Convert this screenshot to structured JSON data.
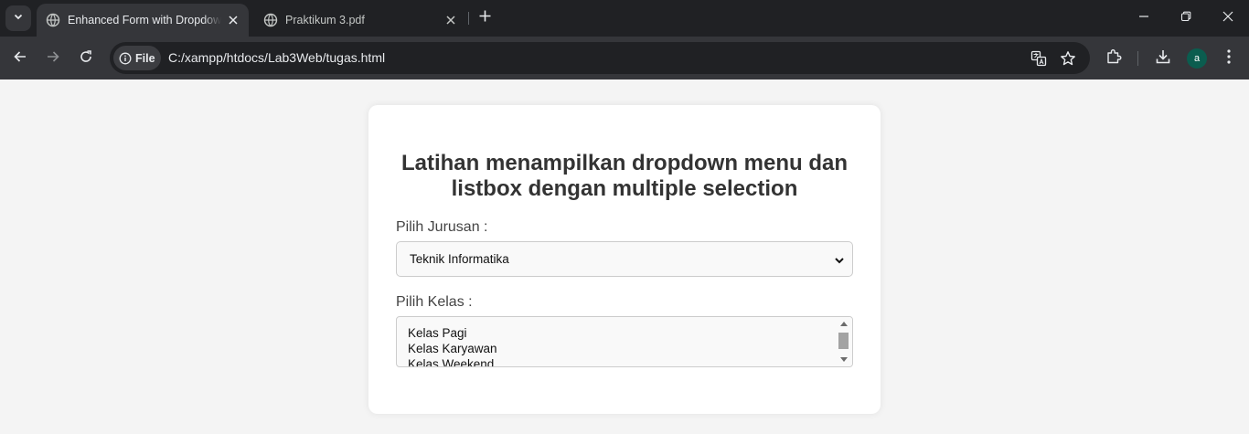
{
  "browser": {
    "tabs": [
      {
        "title": "Enhanced Form with Dropdown and Listbox",
        "active": true
      },
      {
        "title": "Praktikum 3.pdf",
        "active": false
      }
    ],
    "address": {
      "chip_label": "File",
      "url": "C:/xampp/htdocs/Lab3Web/tugas.html"
    },
    "profile_initial": "a",
    "icons": [
      "tab-search-icon",
      "globe-icon",
      "close-icon",
      "plus-icon",
      "minimize-icon",
      "restore-icon",
      "back-icon",
      "forward-icon",
      "reload-icon",
      "info-icon",
      "translate-icon",
      "star-icon",
      "extensions-icon",
      "download-icon",
      "more-icon"
    ]
  },
  "form": {
    "heading": "Latihan menampilkan dropdown menu dan listbox dengan multiple selection",
    "jurusan_label": "Pilih Jurusan :",
    "jurusan_selected": "Teknik Informatika",
    "kelas_label": "Pilih Kelas :",
    "kelas_options": [
      "Kelas Pagi",
      "Kelas Karyawan",
      "Kelas Weekend"
    ]
  },
  "colors": {
    "page_background": "#f4f4f4",
    "card_background": "#ffffff",
    "heading_text": "#333333",
    "browser_frame": "#202124",
    "browser_toolbar": "#35363a",
    "avatar": "#0b5d4f"
  }
}
